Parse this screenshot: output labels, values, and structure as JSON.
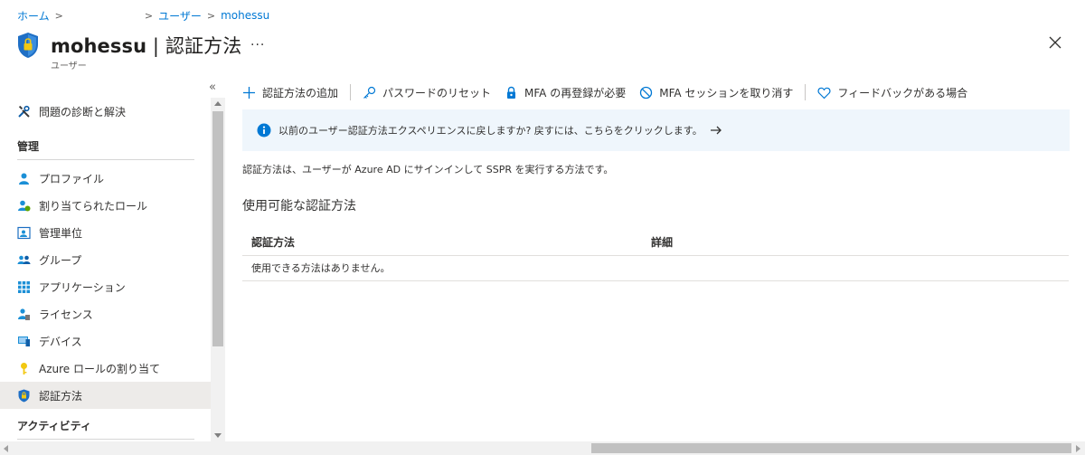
{
  "breadcrumb": {
    "home": "ホーム",
    "users": "ユーザー",
    "user": "mohessu"
  },
  "header": {
    "title_name": "mohessu",
    "title_sep": " | ",
    "title_page": "認証方法",
    "more": "...",
    "subtitle": "ユーザー"
  },
  "sidebar": {
    "collapse": "«",
    "diagnose": "問題の診断と解決",
    "section_manage": "管理",
    "items": [
      {
        "label": "プロファイル",
        "icon": "profile-icon"
      },
      {
        "label": "割り当てられたロール",
        "icon": "assigned-roles-icon"
      },
      {
        "label": "管理単位",
        "icon": "admin-units-icon"
      },
      {
        "label": "グループ",
        "icon": "groups-icon"
      },
      {
        "label": "アプリケーション",
        "icon": "applications-icon"
      },
      {
        "label": "ライセンス",
        "icon": "licenses-icon"
      },
      {
        "label": "デバイス",
        "icon": "devices-icon"
      },
      {
        "label": "Azure ロールの割り当て",
        "icon": "azure-role-key-icon"
      },
      {
        "label": "認証方法",
        "icon": "auth-methods-shield-icon",
        "active": true
      }
    ],
    "section_activity": "アクティビティ"
  },
  "toolbar": {
    "add": "認証方法の追加",
    "reset_password": "パスワードのリセット",
    "mfa_reregister": "MFA の再登録が必要",
    "revoke_mfa": "MFA セッションを取り消す",
    "feedback": "フィードバックがある場合"
  },
  "banner": {
    "text": "以前のユーザー認証方法エクスペリエンスに戻しますか? 戻すには、こちらをクリックします。"
  },
  "content": {
    "description": "認証方法は、ユーザーが Azure AD にサインインして SSPR を実行する方法です。",
    "section_title": "使用可能な認証方法",
    "table": {
      "col_method": "認証方法",
      "col_details": "詳細",
      "empty": "使用できる方法はありません。"
    }
  },
  "colors": {
    "accent": "#0078d4",
    "banner_bg": "#eff6fc",
    "active_bg": "#edebe9"
  }
}
